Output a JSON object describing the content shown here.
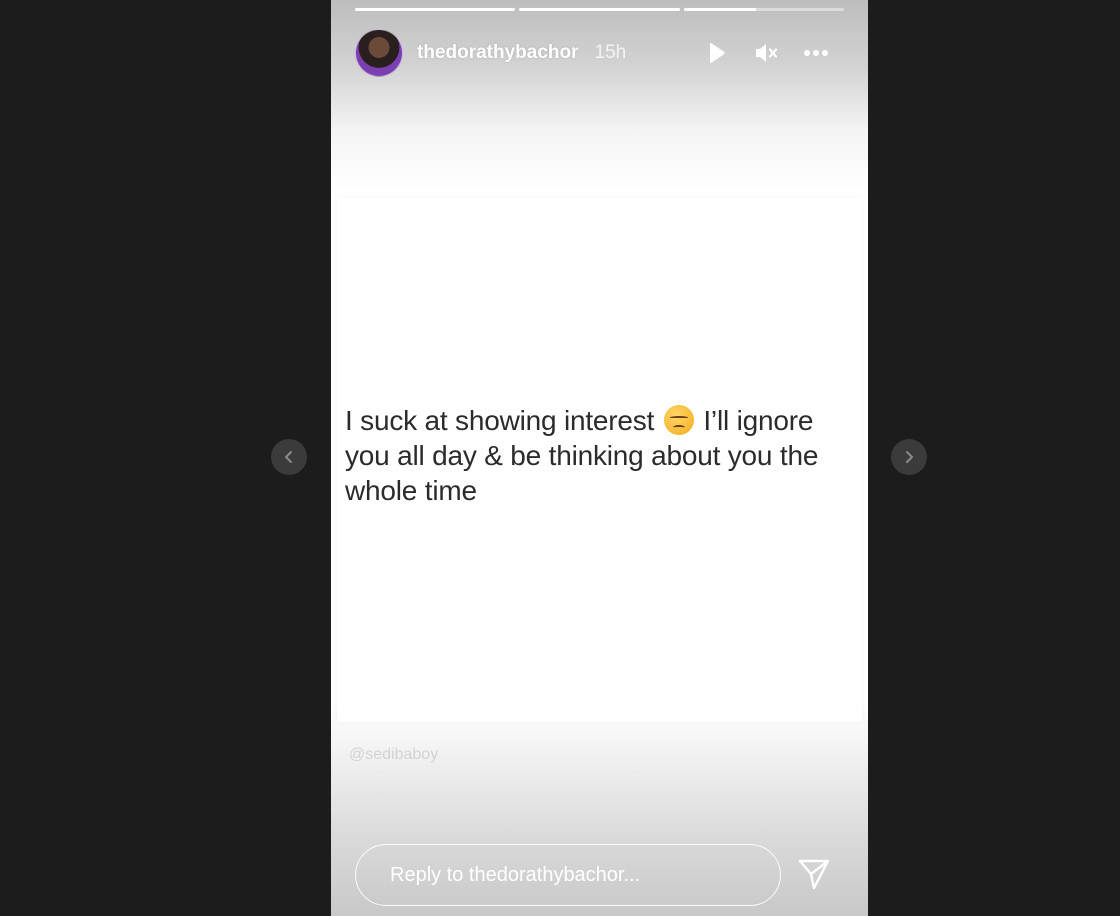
{
  "story": {
    "username": "thedorathybachor",
    "time_ago": "15h",
    "progress": [
      1.0,
      1.0,
      0.45
    ],
    "quote": {
      "part1": "I suck at showing interest ",
      "emoji": "unamused-face-emoji",
      "part2": " I’ll ignore you all day & be thinking about you the whole time"
    },
    "watermark": "@sedibaboy",
    "reply_placeholder": "Reply to thedorathybachor..."
  },
  "controls": {
    "play": "play-icon",
    "mute": "mute-icon",
    "more": "more-icon",
    "send": "send-icon",
    "prev": "chevron-left-icon",
    "next": "chevron-right-icon"
  },
  "colors": {
    "page_background": "#1c1c1c",
    "nav_button": "#3b3b3b",
    "text": "#2b2b2b"
  }
}
